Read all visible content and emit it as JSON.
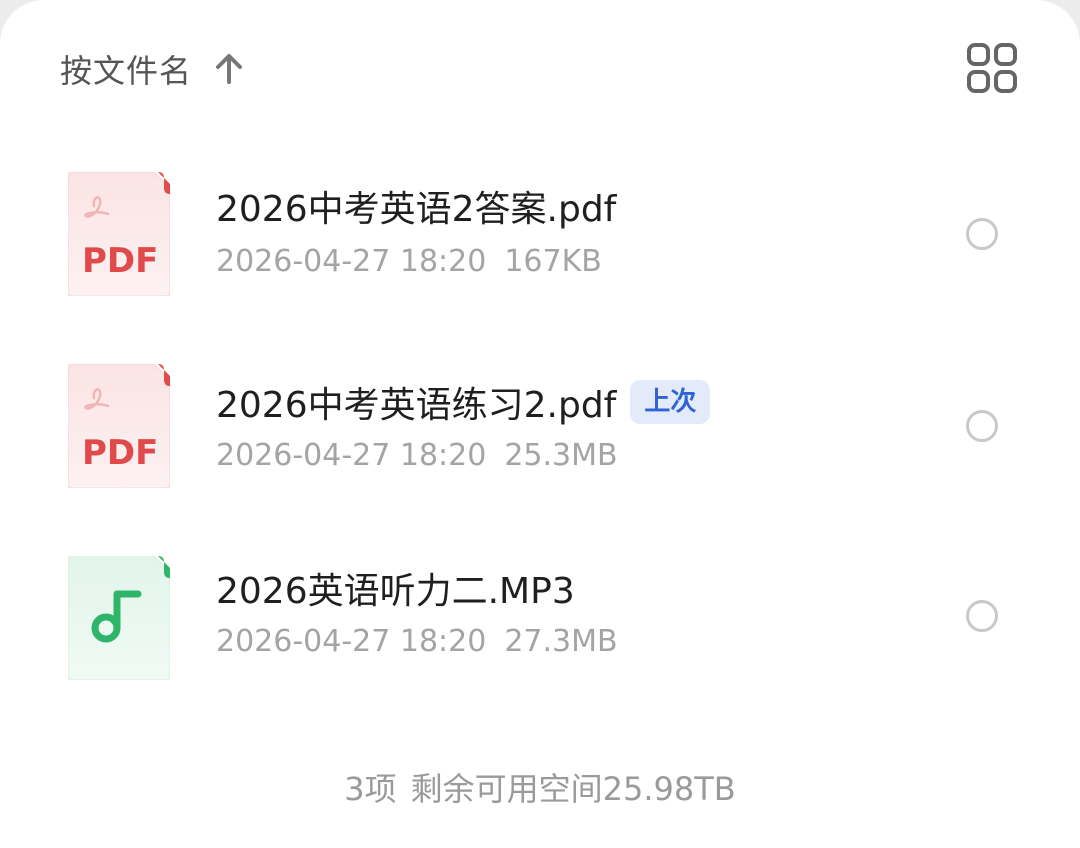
{
  "sort": {
    "label": "按文件名",
    "arrow_icon": "arrow-up-icon"
  },
  "view_toggle_icon": "grid-view-icon",
  "files": [
    {
      "name": "2026中考英语2答案.pdf",
      "date": "2026-04-27 18:20",
      "size": "167KB",
      "type": "pdf",
      "icon_label": "PDF",
      "badge": ""
    },
    {
      "name": "2026中考英语练习2.pdf",
      "date": "2026-04-27 18:20",
      "size": "25.3MB",
      "type": "pdf",
      "icon_label": "PDF",
      "badge": "上次"
    },
    {
      "name": "2026英语听力二.MP3",
      "date": "2026-04-27 18:20",
      "size": "27.3MB",
      "type": "audio",
      "icon_label": "",
      "badge": ""
    }
  ],
  "footer": {
    "count": "3项",
    "space": "剩余可用空间25.98TB"
  },
  "colors": {
    "pdf_red": "#e04a4a",
    "audio_green": "#2fb56a",
    "badge_bg": "#e3ebfb",
    "badge_text": "#2f63d4"
  }
}
